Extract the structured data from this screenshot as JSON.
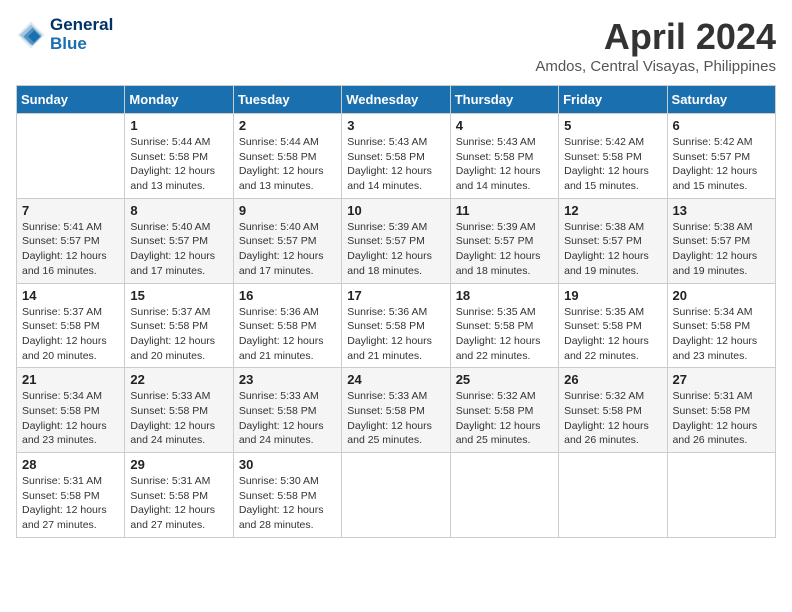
{
  "header": {
    "logo_line1": "General",
    "logo_line2": "Blue",
    "month": "April 2024",
    "location": "Amdos, Central Visayas, Philippines"
  },
  "days_of_week": [
    "Sunday",
    "Monday",
    "Tuesday",
    "Wednesday",
    "Thursday",
    "Friday",
    "Saturday"
  ],
  "weeks": [
    [
      {
        "day": "",
        "content": ""
      },
      {
        "day": "1",
        "content": "Sunrise: 5:44 AM\nSunset: 5:58 PM\nDaylight: 12 hours\nand 13 minutes."
      },
      {
        "day": "2",
        "content": "Sunrise: 5:44 AM\nSunset: 5:58 PM\nDaylight: 12 hours\nand 13 minutes."
      },
      {
        "day": "3",
        "content": "Sunrise: 5:43 AM\nSunset: 5:58 PM\nDaylight: 12 hours\nand 14 minutes."
      },
      {
        "day": "4",
        "content": "Sunrise: 5:43 AM\nSunset: 5:58 PM\nDaylight: 12 hours\nand 14 minutes."
      },
      {
        "day": "5",
        "content": "Sunrise: 5:42 AM\nSunset: 5:58 PM\nDaylight: 12 hours\nand 15 minutes."
      },
      {
        "day": "6",
        "content": "Sunrise: 5:42 AM\nSunset: 5:57 PM\nDaylight: 12 hours\nand 15 minutes."
      }
    ],
    [
      {
        "day": "7",
        "content": "Sunrise: 5:41 AM\nSunset: 5:57 PM\nDaylight: 12 hours\nand 16 minutes."
      },
      {
        "day": "8",
        "content": "Sunrise: 5:40 AM\nSunset: 5:57 PM\nDaylight: 12 hours\nand 17 minutes."
      },
      {
        "day": "9",
        "content": "Sunrise: 5:40 AM\nSunset: 5:57 PM\nDaylight: 12 hours\nand 17 minutes."
      },
      {
        "day": "10",
        "content": "Sunrise: 5:39 AM\nSunset: 5:57 PM\nDaylight: 12 hours\nand 18 minutes."
      },
      {
        "day": "11",
        "content": "Sunrise: 5:39 AM\nSunset: 5:57 PM\nDaylight: 12 hours\nand 18 minutes."
      },
      {
        "day": "12",
        "content": "Sunrise: 5:38 AM\nSunset: 5:57 PM\nDaylight: 12 hours\nand 19 minutes."
      },
      {
        "day": "13",
        "content": "Sunrise: 5:38 AM\nSunset: 5:57 PM\nDaylight: 12 hours\nand 19 minutes."
      }
    ],
    [
      {
        "day": "14",
        "content": "Sunrise: 5:37 AM\nSunset: 5:58 PM\nDaylight: 12 hours\nand 20 minutes."
      },
      {
        "day": "15",
        "content": "Sunrise: 5:37 AM\nSunset: 5:58 PM\nDaylight: 12 hours\nand 20 minutes."
      },
      {
        "day": "16",
        "content": "Sunrise: 5:36 AM\nSunset: 5:58 PM\nDaylight: 12 hours\nand 21 minutes."
      },
      {
        "day": "17",
        "content": "Sunrise: 5:36 AM\nSunset: 5:58 PM\nDaylight: 12 hours\nand 21 minutes."
      },
      {
        "day": "18",
        "content": "Sunrise: 5:35 AM\nSunset: 5:58 PM\nDaylight: 12 hours\nand 22 minutes."
      },
      {
        "day": "19",
        "content": "Sunrise: 5:35 AM\nSunset: 5:58 PM\nDaylight: 12 hours\nand 22 minutes."
      },
      {
        "day": "20",
        "content": "Sunrise: 5:34 AM\nSunset: 5:58 PM\nDaylight: 12 hours\nand 23 minutes."
      }
    ],
    [
      {
        "day": "21",
        "content": "Sunrise: 5:34 AM\nSunset: 5:58 PM\nDaylight: 12 hours\nand 23 minutes."
      },
      {
        "day": "22",
        "content": "Sunrise: 5:33 AM\nSunset: 5:58 PM\nDaylight: 12 hours\nand 24 minutes."
      },
      {
        "day": "23",
        "content": "Sunrise: 5:33 AM\nSunset: 5:58 PM\nDaylight: 12 hours\nand 24 minutes."
      },
      {
        "day": "24",
        "content": "Sunrise: 5:33 AM\nSunset: 5:58 PM\nDaylight: 12 hours\nand 25 minutes."
      },
      {
        "day": "25",
        "content": "Sunrise: 5:32 AM\nSunset: 5:58 PM\nDaylight: 12 hours\nand 25 minutes."
      },
      {
        "day": "26",
        "content": "Sunrise: 5:32 AM\nSunset: 5:58 PM\nDaylight: 12 hours\nand 26 minutes."
      },
      {
        "day": "27",
        "content": "Sunrise: 5:31 AM\nSunset: 5:58 PM\nDaylight: 12 hours\nand 26 minutes."
      }
    ],
    [
      {
        "day": "28",
        "content": "Sunrise: 5:31 AM\nSunset: 5:58 PM\nDaylight: 12 hours\nand 27 minutes."
      },
      {
        "day": "29",
        "content": "Sunrise: 5:31 AM\nSunset: 5:58 PM\nDaylight: 12 hours\nand 27 minutes."
      },
      {
        "day": "30",
        "content": "Sunrise: 5:30 AM\nSunset: 5:58 PM\nDaylight: 12 hours\nand 28 minutes."
      },
      {
        "day": "",
        "content": ""
      },
      {
        "day": "",
        "content": ""
      },
      {
        "day": "",
        "content": ""
      },
      {
        "day": "",
        "content": ""
      }
    ]
  ]
}
